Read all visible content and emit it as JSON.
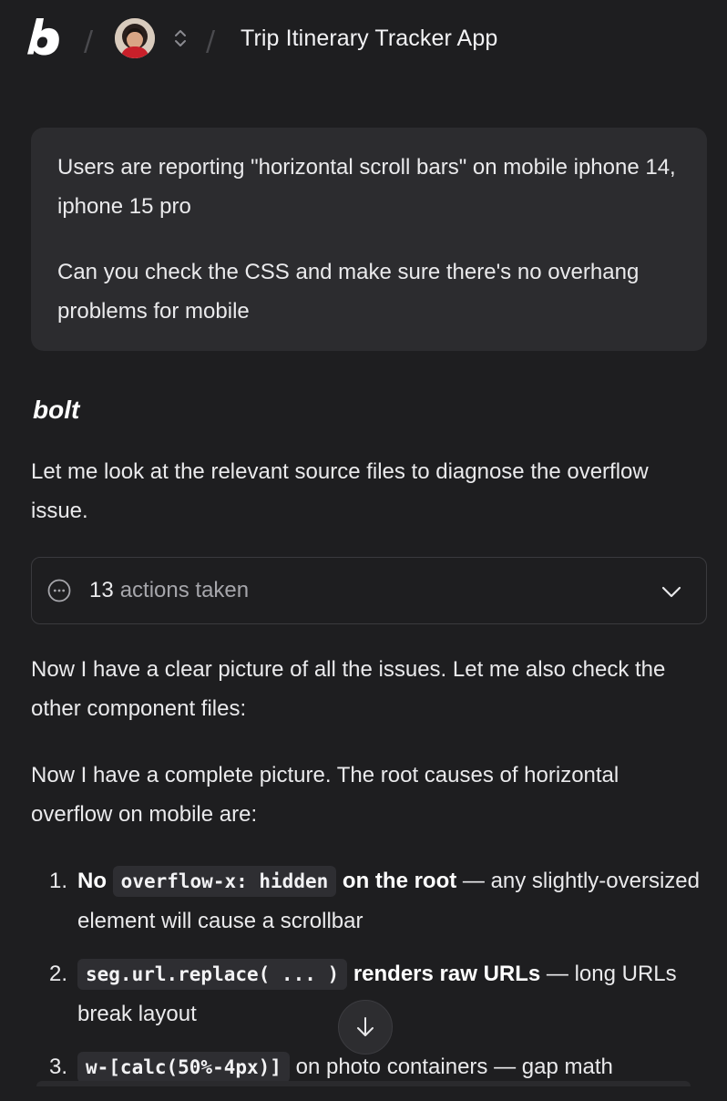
{
  "header": {
    "project_title": "Trip Itinerary Tracker App",
    "separator": "/"
  },
  "user_message": {
    "line1": "Users are reporting \"horizontal scroll bars\" on mobile iphone 14, iphone 15 pro",
    "line2": "Can you check the CSS and make sure there's no overhang problems for mobile"
  },
  "assistant": {
    "name": "bolt",
    "intro": "Let me look at the relevant source files to diagnose the overflow issue.",
    "actions": {
      "count": "13",
      "label": "actions taken"
    },
    "para1": "Now I have a clear picture of all the issues. Let me also check the other component files:",
    "para2": "Now I have a complete picture. The root causes of horizontal overflow on mobile are:",
    "issues": [
      {
        "num": "1.",
        "bold_pre": "No",
        "code": "overflow-x: hidden",
        "bold_post": "on the root",
        "rest": " — any slightly-oversized element will cause a scrollbar"
      },
      {
        "num": "2.",
        "bold_pre": "",
        "code": "seg.url.replace( ... )",
        "bold_post": "renders raw URLs",
        "rest": " — long URLs break layout"
      },
      {
        "num": "3.",
        "bold_pre": "",
        "code": "w-[calc(50%-4px)]",
        "bold_post": "",
        "rest": " on photo containers — gap math"
      }
    ]
  },
  "icons": {
    "logo": "bolt-logo-icon",
    "switcher": "chevron-up-down-icon",
    "actions": "ellipsis-circle-icon",
    "expand": "chevron-down-icon",
    "scroll": "arrow-down-icon"
  },
  "colors": {
    "background": "#1e1e20",
    "bubble": "#2c2c2f",
    "code_bg": "#2e2e32",
    "muted_text": "#a6a6ab"
  }
}
